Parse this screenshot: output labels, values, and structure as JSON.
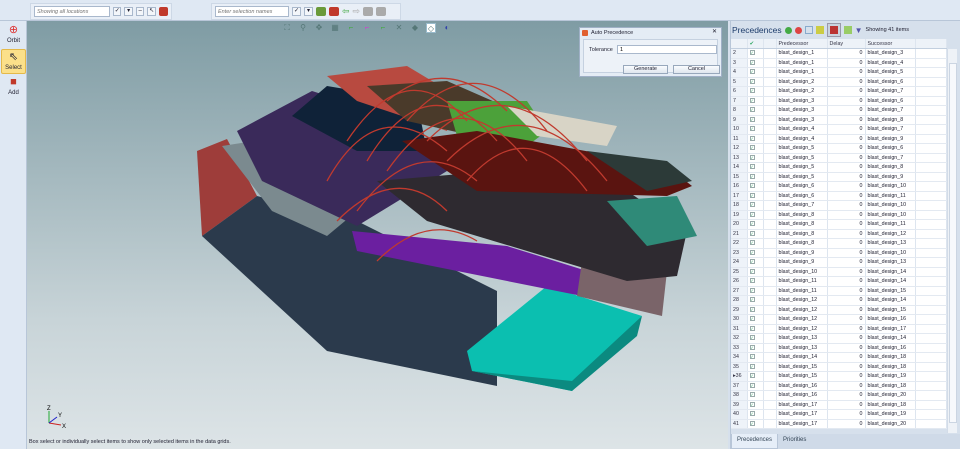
{
  "toolbar": {
    "location_placeholder": "Showing all locations",
    "selection_placeholder": "Enter selection names"
  },
  "left_tools": [
    {
      "label": "Orbit",
      "icon": "orbit-icon"
    },
    {
      "label": "Select",
      "icon": "cursor-icon",
      "active": true
    },
    {
      "label": "Add",
      "icon": "add-block-icon"
    }
  ],
  "status_text": "Box select or individually select items to show only selected items in the data grids.",
  "dialog": {
    "title": "Auto Precedence",
    "tolerance_label": "Tolerance",
    "tolerance_value": "1",
    "generate": "Generate",
    "cancel": "Cancel",
    "close": "✕"
  },
  "panel": {
    "title": "Precedences",
    "showing": "Showing 41 items",
    "columns": [
      "",
      "Predecessor",
      "Delay",
      "Successor"
    ],
    "rows": [
      [
        2,
        "blast_design_1",
        0,
        "blast_design_3"
      ],
      [
        3,
        "blast_design_1",
        0,
        "blast_design_4"
      ],
      [
        4,
        "blast_design_1",
        0,
        "blast_design_5"
      ],
      [
        5,
        "blast_design_2",
        0,
        "blast_design_6"
      ],
      [
        6,
        "blast_design_2",
        0,
        "blast_design_7"
      ],
      [
        7,
        "blast_design_3",
        0,
        "blast_design_6"
      ],
      [
        8,
        "blast_design_3",
        0,
        "blast_design_7"
      ],
      [
        9,
        "blast_design_3",
        0,
        "blast_design_8"
      ],
      [
        10,
        "blast_design_4",
        0,
        "blast_design_7"
      ],
      [
        11,
        "blast_design_4",
        0,
        "blast_design_9"
      ],
      [
        12,
        "blast_design_5",
        0,
        "blast_design_6"
      ],
      [
        13,
        "blast_design_5",
        0,
        "blast_design_7"
      ],
      [
        14,
        "blast_design_5",
        0,
        "blast_design_8"
      ],
      [
        15,
        "blast_design_5",
        0,
        "blast_design_9"
      ],
      [
        16,
        "blast_design_6",
        0,
        "blast_design_10"
      ],
      [
        17,
        "blast_design_6",
        0,
        "blast_design_11"
      ],
      [
        18,
        "blast_design_7",
        0,
        "blast_design_10"
      ],
      [
        19,
        "blast_design_8",
        0,
        "blast_design_10"
      ],
      [
        20,
        "blast_design_8",
        0,
        "blast_design_11"
      ],
      [
        21,
        "blast_design_8",
        0,
        "blast_design_12"
      ],
      [
        22,
        "blast_design_8",
        0,
        "blast_design_13"
      ],
      [
        23,
        "blast_design_9",
        0,
        "blast_design_10"
      ],
      [
        24,
        "blast_design_9",
        0,
        "blast_design_13"
      ],
      [
        25,
        "blast_design_10",
        0,
        "blast_design_14"
      ],
      [
        26,
        "blast_design_11",
        0,
        "blast_design_14"
      ],
      [
        27,
        "blast_design_11",
        0,
        "blast_design_15"
      ],
      [
        28,
        "blast_design_12",
        0,
        "blast_design_14"
      ],
      [
        29,
        "blast_design_12",
        0,
        "blast_design_15"
      ],
      [
        30,
        "blast_design_12",
        0,
        "blast_design_16"
      ],
      [
        31,
        "blast_design_12",
        0,
        "blast_design_17"
      ],
      [
        32,
        "blast_design_13",
        0,
        "blast_design_14"
      ],
      [
        33,
        "blast_design_13",
        0,
        "blast_design_16"
      ],
      [
        34,
        "blast_design_14",
        0,
        "blast_design_18"
      ],
      [
        35,
        "blast_design_15",
        0,
        "blast_design_18"
      ],
      [
        36,
        "blast_design_15",
        0,
        "blast_design_19"
      ],
      [
        37,
        "blast_design_16",
        0,
        "blast_design_18"
      ],
      [
        38,
        "blast_design_16",
        0,
        "blast_design_20"
      ],
      [
        39,
        "blast_design_17",
        0,
        "blast_design_18"
      ],
      [
        40,
        "blast_design_17",
        0,
        "blast_design_19"
      ],
      [
        41,
        "blast_design_17",
        0,
        "blast_design_20"
      ]
    ],
    "current_row": 36,
    "tabs": [
      "Precedences",
      "Priorities"
    ]
  },
  "axes": {
    "x": "X",
    "y": "Y",
    "z": "Z"
  }
}
